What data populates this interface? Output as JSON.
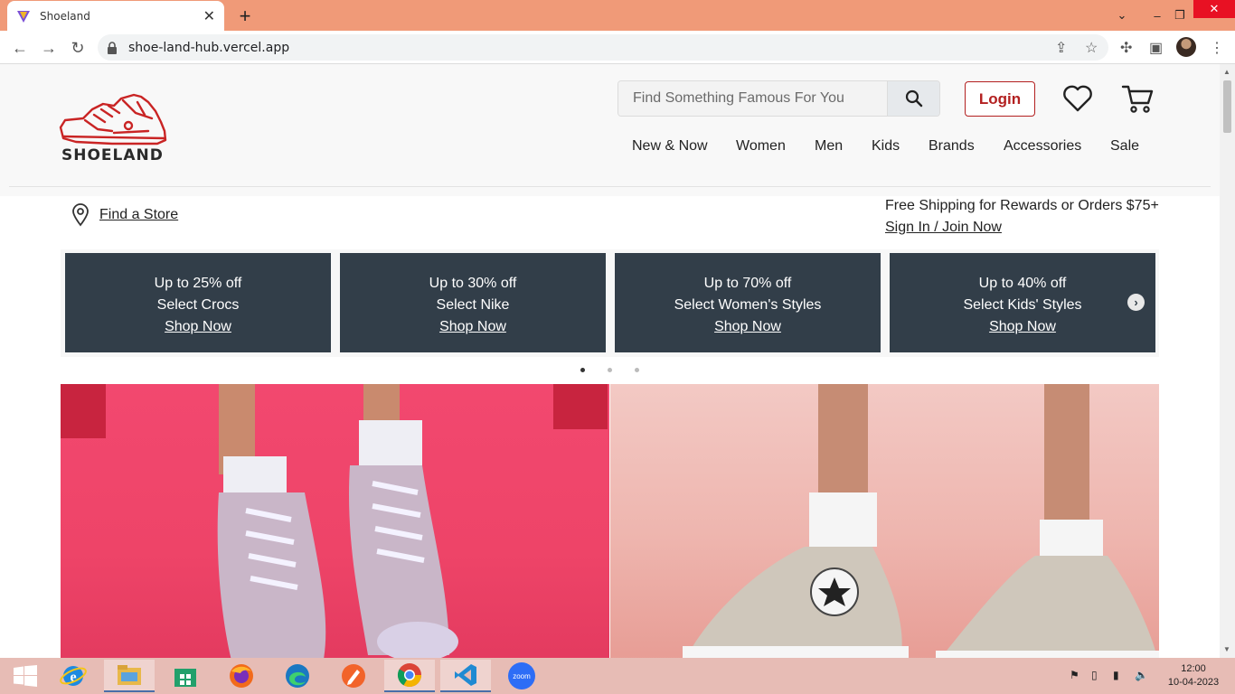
{
  "browser": {
    "tab_title": "Shoeland",
    "url": "shoe-land-hub.vercel.app"
  },
  "header": {
    "logo_text": "SHOELAND",
    "search_placeholder": "Find Something Famous For You",
    "login_label": "Login",
    "nav": [
      "New & Now",
      "Women",
      "Men",
      "Kids",
      "Brands",
      "Accessories",
      "Sale"
    ]
  },
  "store_bar": {
    "find_store": "Find a Store",
    "shipping_text": "Free Shipping for Rewards or Orders $75+",
    "signin_link": "Sign In / Join Now"
  },
  "promos": [
    {
      "discount": "Up to 25% off",
      "subject": "Select Crocs",
      "cta": "Shop Now"
    },
    {
      "discount": "Up to 30% off",
      "subject": "Select Nike",
      "cta": "Shop Now"
    },
    {
      "discount": "Up to 70% off",
      "subject": "Select Women's Styles",
      "cta": "Shop Now"
    },
    {
      "discount": "Up to 40% off",
      "subject": "Select Kids' Styles",
      "cta": "Shop Now"
    }
  ],
  "carousel": {
    "pages": 3,
    "active": 1
  },
  "taskbar": {
    "clock_time": "12:00",
    "clock_date": "10-04-2023",
    "apps": [
      "internet-explorer",
      "file-explorer",
      "store",
      "firefox",
      "edge",
      "editor",
      "chrome",
      "vscode",
      "zoom"
    ]
  },
  "colors": {
    "tab_strip": "#f09a78",
    "brand_red": "#b32020",
    "promo_bg": "#323e49",
    "taskbar": "#e7bcb5"
  }
}
